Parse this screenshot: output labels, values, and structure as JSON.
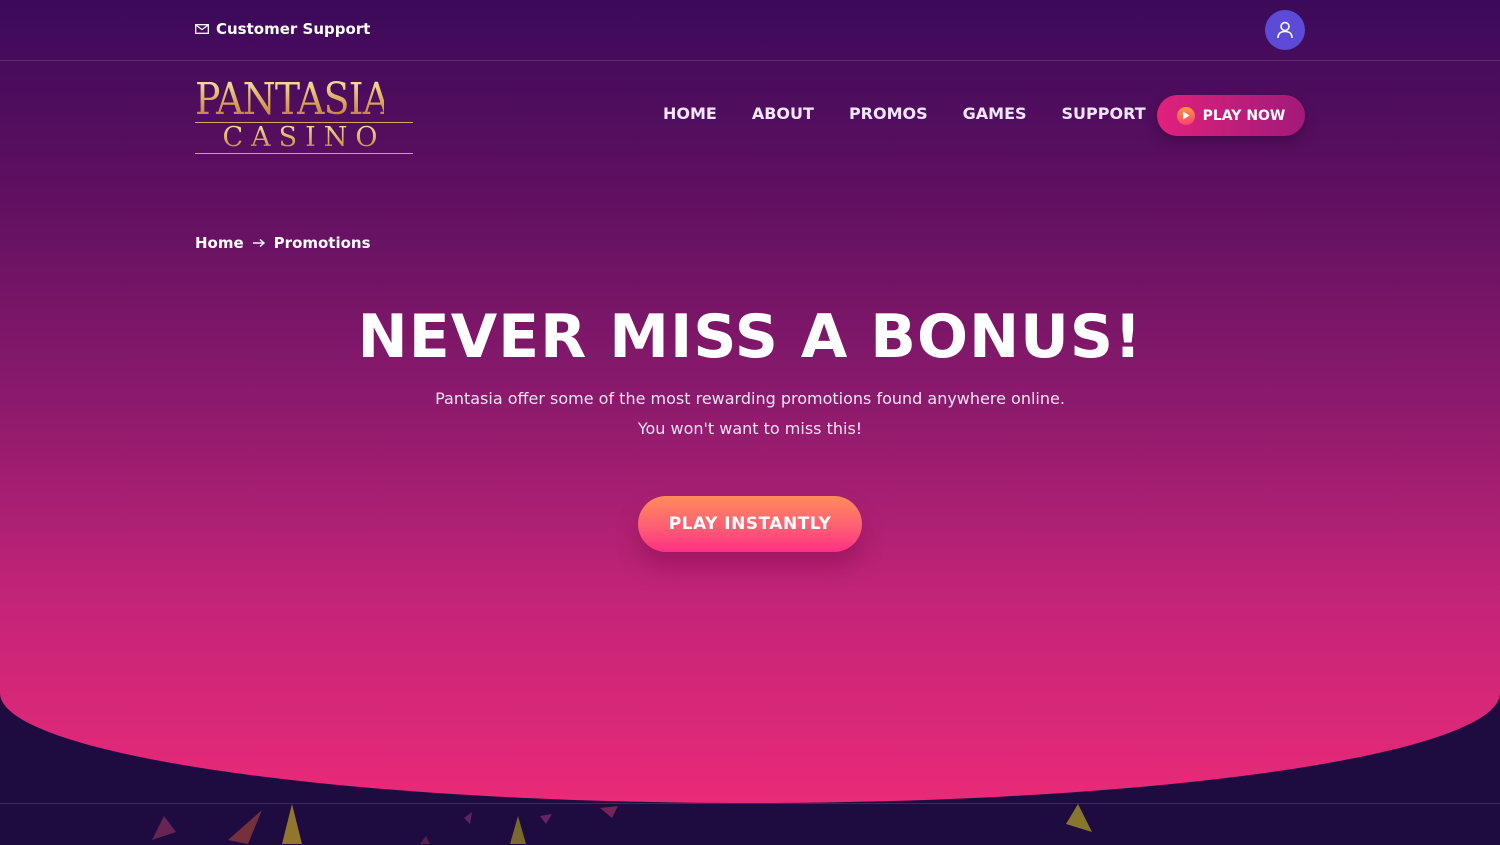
{
  "topbar": {
    "support_label": "Customer Support",
    "mail_icon": "mail-icon",
    "account_icon": "user-icon"
  },
  "brand": {
    "logo_top": "PANTASIA",
    "logo_bottom": "CASINO"
  },
  "nav": {
    "items": [
      "HOME",
      "ABOUT",
      "PROMOS",
      "GAMES",
      "SUPPORT"
    ]
  },
  "header_cta": {
    "label": "PLAY NOW",
    "icon": "play-icon"
  },
  "breadcrumb": {
    "home": "Home",
    "separator_icon": "arrow-right-icon",
    "current": "Promotions"
  },
  "hero": {
    "title": "NEVER MISS A BONUS!",
    "subtitle_line1": "Pantasia offer some of the most rewarding promotions found anywhere online.",
    "subtitle_line2": "You won't want to miss this!",
    "cta_label": "PLAY INSTANTLY"
  },
  "colors": {
    "accent_pink": "#e92a78",
    "deep_purple": "#3c0a5a",
    "account_blue": "#5b4bd6",
    "gold": "#d9a65a"
  }
}
